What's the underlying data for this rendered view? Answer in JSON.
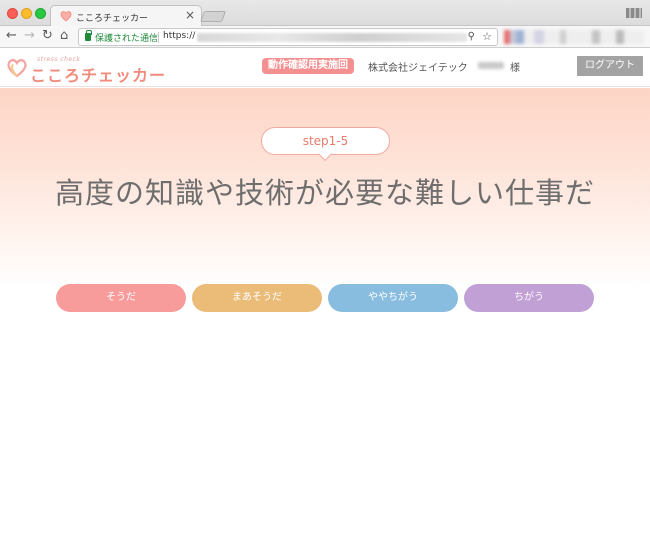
{
  "browser": {
    "tab_title": "こころチェッカー",
    "secure_label": "保護された通信",
    "url_prefix": "https://",
    "colors": {
      "secure": "#1e8a3a"
    }
  },
  "header": {
    "logo_sub": "stress check",
    "logo_text": "こころチェッカー",
    "mode_badge": "動作確認用実施回",
    "company": "株式会社ジェイテック",
    "honorific": "様",
    "logout_label": "ログアウト"
  },
  "question": {
    "step_label": "step1-5",
    "text": "高度の知識や技術が必要な難しい仕事だ"
  },
  "answers": [
    {
      "label": "そうだ",
      "color": "#f79c9b"
    },
    {
      "label": "まあそうだ",
      "color": "#ebbb78"
    },
    {
      "label": "ややちがう",
      "color": "#89bde0"
    },
    {
      "label": "ちがう",
      "color": "#c1a0d6"
    }
  ]
}
